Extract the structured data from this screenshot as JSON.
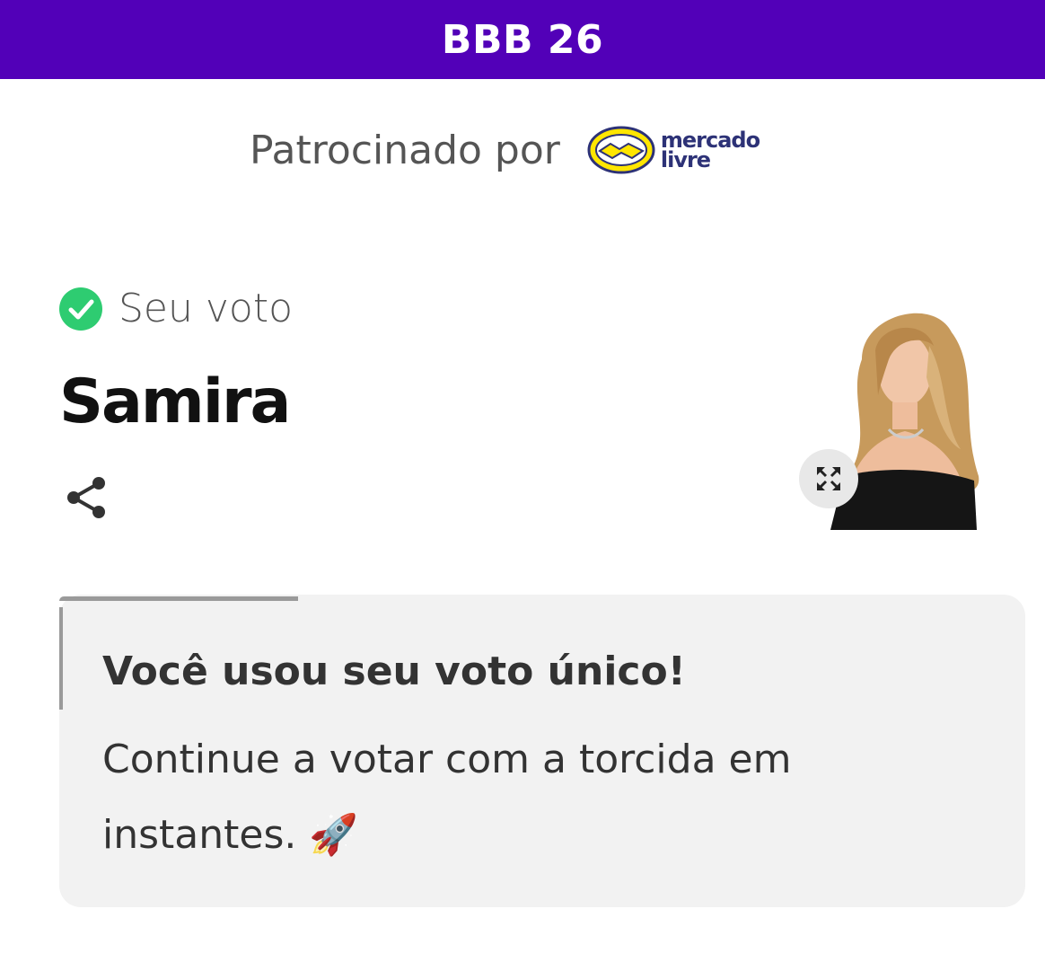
{
  "header": {
    "title": "BBB 26"
  },
  "sponsor": {
    "label": "Patrocinado por",
    "logo_line1": "mercado",
    "logo_line2": "livre"
  },
  "vote": {
    "status_label": "Seu voto",
    "candidate": "Samira"
  },
  "message": {
    "title": "Você usou seu voto único!",
    "body": "Continue a votar com a torcida em instantes. 🚀"
  },
  "colors": {
    "header_bg": "#5200b8",
    "check_green": "#2ecc71",
    "card_bg": "#f2f2f2"
  },
  "icons": [
    "check-circle-icon",
    "share-icon",
    "expand-icon",
    "mercado-livre-handshake-logo"
  ]
}
